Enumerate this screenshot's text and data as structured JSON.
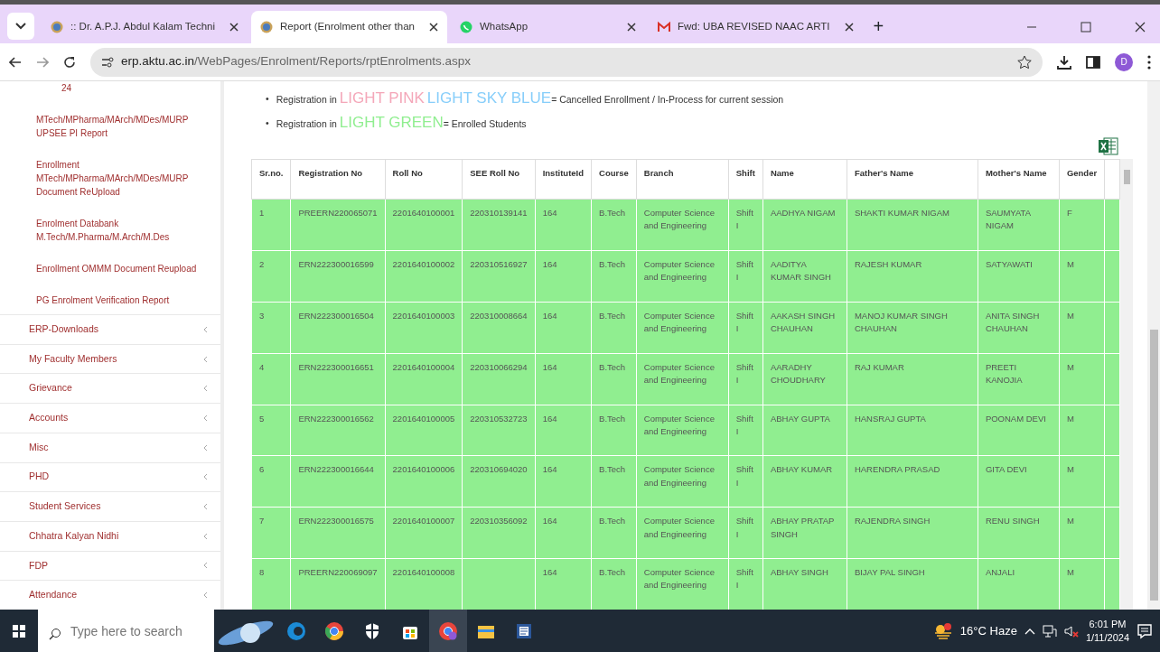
{
  "browser": {
    "tabs": [
      {
        "title": ":: Dr. A.P.J. Abdul Kalam Techni",
        "kind": "site",
        "selected": false
      },
      {
        "title": "Report (Enrolment other than",
        "kind": "site",
        "selected": true
      },
      {
        "title": "WhatsApp",
        "kind": "chat",
        "selected": false
      },
      {
        "title": "Fwd: UBA REVISED NAAC ARTI",
        "kind": "mail",
        "selected": false
      }
    ],
    "new_tab": "+",
    "address": {
      "domain": "erp.aktu.ac.in",
      "path": "/WebPages/Enrolment/Reports/rptEnrolments.aspx"
    },
    "profile": "D"
  },
  "sidebar": {
    "sub_items": [
      "24",
      "MTech/MPharma/MArch/MDes/MURP UPSEE PI Report",
      "Enrollment MTech/MPharma/MArch/MDes/MURP Document ReUpload",
      "Enrolment Databank M.Tech/M.Pharma/M.Arch/M.Des",
      "Enrollment OMMM Document Reupload",
      "PG Enrolment Verification Report"
    ],
    "menu": [
      {
        "label": "ERP-Downloads",
        "expanded": false
      },
      {
        "label": "My Faculty Members",
        "expanded": false
      },
      {
        "label": "Grievance",
        "expanded": false
      },
      {
        "label": "Accounts",
        "expanded": false
      },
      {
        "label": "Misc",
        "expanded": false
      },
      {
        "label": "PHD",
        "expanded": false
      },
      {
        "label": "Student Services",
        "expanded": false
      },
      {
        "label": "Chhatra Kalyan Nidhi",
        "expanded": false
      },
      {
        "label": "FDP",
        "expanded": false
      },
      {
        "label": "Attendance",
        "expanded": false
      }
    ]
  },
  "legend": [
    {
      "bullet": "•",
      "prefix": "Registration in",
      "highlights": [
        {
          "text": "LIGHT PINK",
          "color": "#f4a7b9"
        },
        {
          "text": "LIGHT SKY BLUE",
          "color": "#87cefa"
        }
      ],
      "suffix": "= Cancelled Enrollment / In-Process for current session"
    },
    {
      "bullet": "•",
      "prefix": "Registration in",
      "highlights": [
        {
          "text": "LIGHT GREEN",
          "color": "#90ee90"
        }
      ],
      "suffix": "= Enrolled Students"
    }
  ],
  "table": {
    "columns": [
      "Sr.no.",
      "Registration No",
      "Roll No",
      "SEE Roll No",
      "InstituteId",
      "Course",
      "Branch",
      "Shift",
      "Name",
      "Father's Name",
      "Mother's Name",
      "Gender"
    ],
    "rows": [
      {
        "color": "#90ee90",
        "cells": [
          "1",
          "PREERN220065071",
          "2201640100001",
          "220310139141",
          "164",
          "B.Tech",
          "Computer Science and Engineering",
          "Shift I",
          "AADHYA NIGAM",
          "SHAKTI KUMAR NIGAM",
          "SAUMYATA NIGAM",
          "F"
        ]
      },
      {
        "color": "#90ee90",
        "cells": [
          "2",
          "ERN222300016599",
          "2201640100002",
          "220310516927",
          "164",
          "B.Tech",
          "Computer Science and Engineering",
          "Shift I",
          "AADITYA KUMAR SINGH",
          "RAJESH KUMAR",
          "SATYAWATI",
          "M"
        ]
      },
      {
        "color": "#90ee90",
        "cells": [
          "3",
          "ERN222300016504",
          "2201640100003",
          "220310008664",
          "164",
          "B.Tech",
          "Computer Science and Engineering",
          "Shift I",
          "AAKASH SINGH CHAUHAN",
          "MANOJ KUMAR SINGH CHAUHAN",
          "ANITA SINGH CHAUHAN",
          "M"
        ]
      },
      {
        "color": "#90ee90",
        "cells": [
          "4",
          "ERN222300016651",
          "2201640100004",
          "220310066294",
          "164",
          "B.Tech",
          "Computer Science and Engineering",
          "Shift I",
          "AARADHY CHOUDHARY",
          "RAJ KUMAR",
          "PREETI KANOJIA",
          "M"
        ]
      },
      {
        "color": "#90ee90",
        "cells": [
          "5",
          "ERN222300016562",
          "2201640100005",
          "220310532723",
          "164",
          "B.Tech",
          "Computer Science and Engineering",
          "Shift I",
          "ABHAY GUPTA",
          "HANSRAJ GUPTA",
          "POONAM DEVI",
          "M"
        ]
      },
      {
        "color": "#90ee90",
        "cells": [
          "6",
          "ERN222300016644",
          "2201640100006",
          "220310694020",
          "164",
          "B.Tech",
          "Computer Science and Engineering",
          "Shift I",
          "ABHAY KUMAR",
          "HARENDRA PRASAD",
          "GITA DEVI",
          "M"
        ]
      },
      {
        "color": "#90ee90",
        "cells": [
          "7",
          "ERN222300016575",
          "2201640100007",
          "220310356092",
          "164",
          "B.Tech",
          "Computer Science and Engineering",
          "Shift I",
          "ABHAY PRATAP SINGH",
          "RAJENDRA SINGH",
          "RENU SINGH",
          "M"
        ]
      },
      {
        "color": "#90ee90",
        "cells": [
          "8",
          "PREERN220069097",
          "2201640100008",
          "",
          "164",
          "B.Tech",
          "Computer Science and Engineering",
          "Shift I",
          "ABHAY SINGH",
          "BIJAY PAL SINGH",
          "ANJALI",
          "M"
        ]
      }
    ]
  },
  "taskbar": {
    "search_placeholder": "Type here to search",
    "weather": "16°C  Haze",
    "time": "6:01 PM",
    "date": "1/11/2024"
  }
}
